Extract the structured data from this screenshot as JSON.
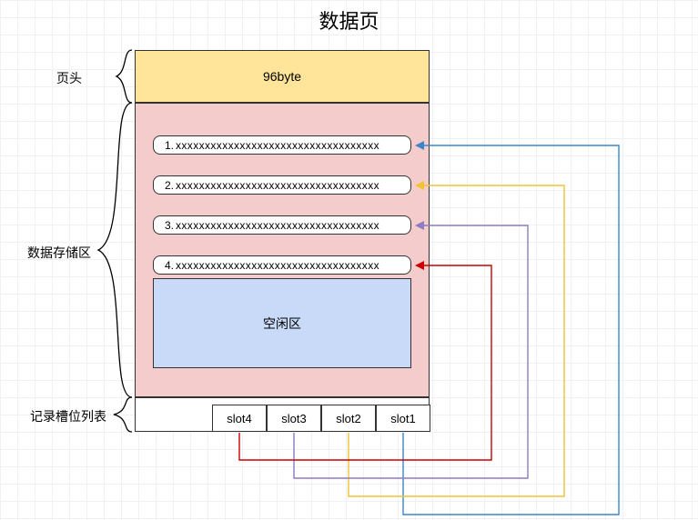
{
  "title": "数据页",
  "labels": {
    "header": "页头",
    "storage": "数据存储区",
    "slots": "记录槽位列表"
  },
  "header": "96byte",
  "rows": [
    {
      "n": "1.",
      "c": "xxxxxxxxxxxxxxxxxxxxxxxxxxxxxxxxxxx"
    },
    {
      "n": "2.",
      "c": "xxxxxxxxxxxxxxxxxxxxxxxxxxxxxxxxxxx"
    },
    {
      "n": "3.",
      "c": "xxxxxxxxxxxxxxxxxxxxxxxxxxxxxxxxxxx"
    },
    {
      "n": "4.",
      "c": "xxxxxxxxxxxxxxxxxxxxxxxxxxxxxxxxxxx"
    }
  ],
  "idle": "空闲区",
  "slots": [
    "slot4",
    "slot3",
    "slot2",
    "slot1"
  ],
  "arrows": [
    {
      "slot": "slot1",
      "row": 0,
      "color": "#3d85c6"
    },
    {
      "slot": "slot2",
      "row": 1,
      "color": "#f1c232"
    },
    {
      "slot": "slot3",
      "row": 2,
      "color": "#8e7cc3"
    },
    {
      "slot": "slot4",
      "row": 3,
      "color": "#cc0000"
    }
  ]
}
